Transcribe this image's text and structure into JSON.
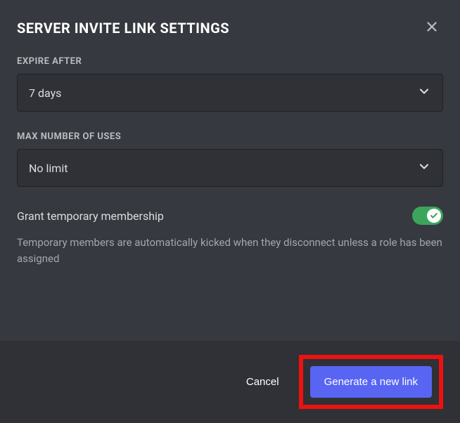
{
  "modal": {
    "title": "SERVER INVITE LINK SETTINGS"
  },
  "expire": {
    "label": "EXPIRE AFTER",
    "value": "7 days"
  },
  "maxUses": {
    "label": "MAX NUMBER OF USES",
    "value": "No limit"
  },
  "tempMembership": {
    "label": "Grant temporary membership",
    "helper": "Temporary members are automatically kicked when they disconnect unless a role has been assigned"
  },
  "footer": {
    "cancel": "Cancel",
    "generate": "Generate a new link"
  }
}
